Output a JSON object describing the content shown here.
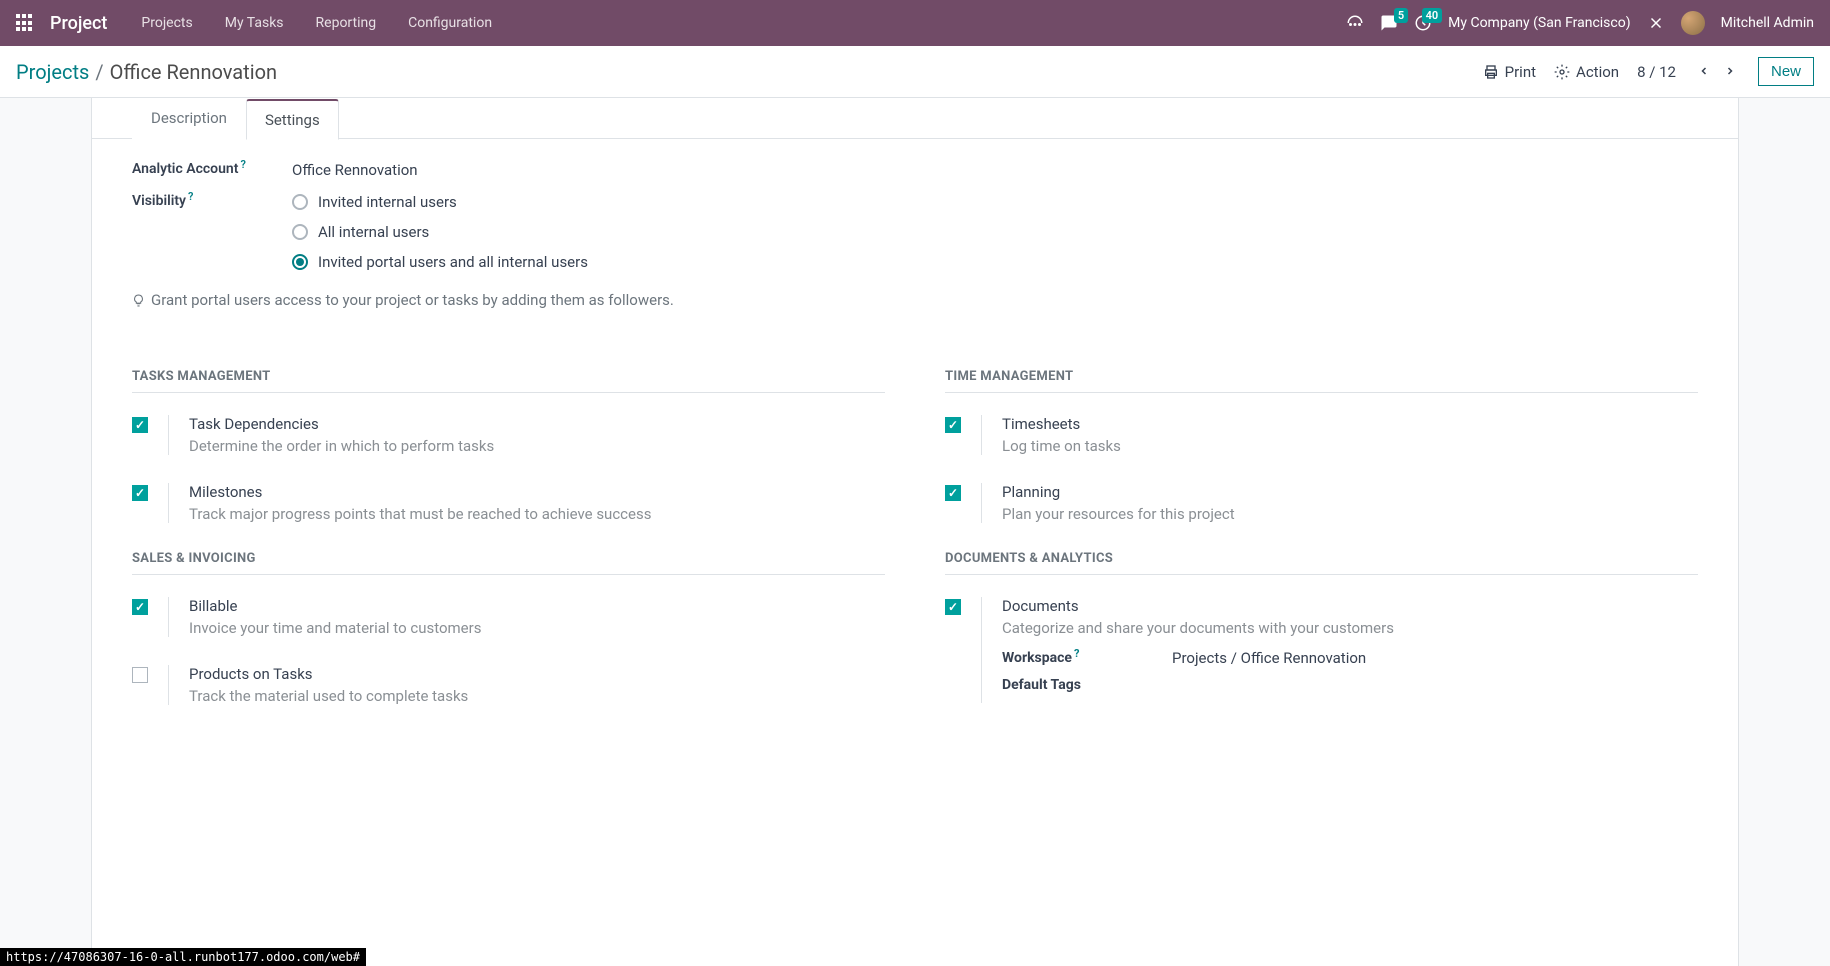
{
  "navbar": {
    "brand": "Project",
    "menu": [
      "Projects",
      "My Tasks",
      "Reporting",
      "Configuration"
    ],
    "messages_badge": "5",
    "activities_badge": "40",
    "company": "My Company (San Francisco)",
    "user": "Mitchell Admin"
  },
  "controlbar": {
    "breadcrumb_root": "Projects",
    "breadcrumb_current": "Office Rennovation",
    "print": "Print",
    "action": "Action",
    "pager": "8 / 12",
    "new": "New"
  },
  "tabs": {
    "description": "Description",
    "settings": "Settings"
  },
  "form": {
    "analytic_label": "Analytic Account",
    "analytic_value": "Office Rennovation",
    "visibility_label": "Visibility",
    "visibility_options": {
      "opt1": "Invited internal users",
      "opt2": "All internal users",
      "opt3": "Invited portal users and all internal users"
    },
    "hint": "Grant portal users access to your project or tasks by adding them as followers."
  },
  "sections": {
    "tasks": {
      "title": "Tasks Management",
      "task_deps": {
        "name": "Task Dependencies",
        "desc": "Determine the order in which to perform tasks"
      },
      "milestones": {
        "name": "Milestones",
        "desc": "Track major progress points that must be reached to achieve success"
      }
    },
    "time": {
      "title": "Time Management",
      "timesheets": {
        "name": "Timesheets",
        "desc": "Log time on tasks"
      },
      "planning": {
        "name": "Planning",
        "desc": "Plan your resources for this project"
      }
    },
    "sales": {
      "title": "Sales & Invoicing",
      "billable": {
        "name": "Billable",
        "desc": "Invoice your time and material to customers"
      },
      "products": {
        "name": "Products on Tasks",
        "desc": "Track the material used to complete tasks"
      }
    },
    "docs": {
      "title": "Documents & Analytics",
      "documents": {
        "name": "Documents",
        "desc": "Categorize and share your documents with your customers",
        "workspace_label": "Workspace",
        "workspace_value": "Projects / Office Rennovation",
        "tags_label": "Default Tags"
      }
    }
  },
  "url_tip": "https://47086307-16-0-all.runbot177.odoo.com/web#"
}
